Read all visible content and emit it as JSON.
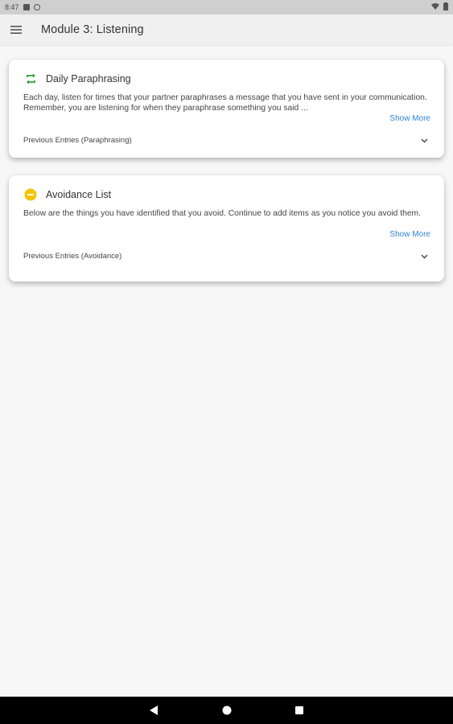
{
  "status_bar": {
    "time": "8:47",
    "icons": [
      "sim-card-icon",
      "data-saver-icon",
      "wifi-icon",
      "battery-icon"
    ]
  },
  "app_bar": {
    "title": "Module 3: Listening",
    "menu_icon": "hamburger-menu-icon"
  },
  "cards": [
    {
      "title": "Daily Paraphrasing",
      "icon": "repeat-icon",
      "icon_color": "#2e9e3a",
      "description": "Each day, listen for times that your partner paraphrases a message that you have sent in your communication. Remember, you are listening for when they paraphrase something you said ...",
      "show_more": "Show More",
      "entries_label": "Previous Entries (Paraphrasing)"
    },
    {
      "title": "Avoidance List",
      "icon": "minus-circle-icon",
      "icon_color": "#f2c500",
      "description": "Below are the things you have identified that you avoid. Continue to add items as you notice you avoid them.",
      "show_more": "Show More",
      "entries_label": "Previous Entries (Avoidance)"
    }
  ],
  "colors": {
    "accent_link": "#2f83d6",
    "background": "#f7f7f7",
    "nav_bar": "#000000"
  },
  "nav_bar": {
    "buttons": [
      "back-icon",
      "home-icon",
      "recents-icon"
    ]
  }
}
